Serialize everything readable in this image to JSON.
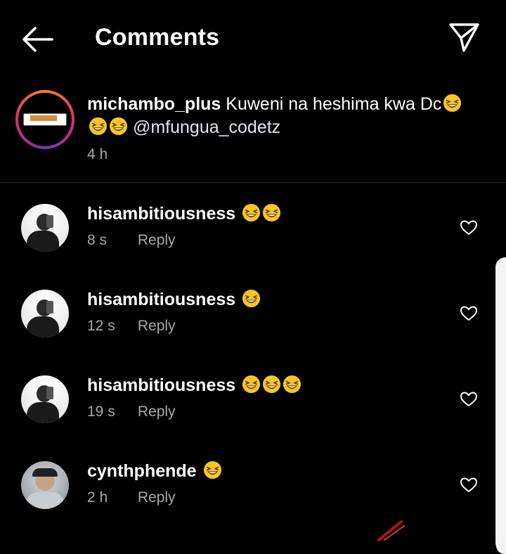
{
  "header": {
    "back_icon": "arrow-left-icon",
    "title": "Comments",
    "share_icon": "paper-plane-icon"
  },
  "caption": {
    "username": "michambo_plus",
    "text_before": "Kuweni na heshima kwa Dc",
    "mention": "@mfungua_codetz",
    "time": "4 h",
    "avatar_ring_colors": [
      "#f58529",
      "#dd2a7b",
      "#8134af"
    ]
  },
  "comments": [
    {
      "username": "hisambitiousness",
      "emoji_count": 2,
      "time": "8 s",
      "reply": "Reply"
    },
    {
      "username": "hisambitiousness",
      "emoji_count": 1,
      "time": "12 s",
      "reply": "Reply"
    },
    {
      "username": "hisambitiousness",
      "emoji_count": 3,
      "time": "19 s",
      "reply": "Reply"
    },
    {
      "username": "cynthphende",
      "emoji_count": 1,
      "time": "2 h",
      "reply": "Reply"
    }
  ],
  "icons": {
    "emoji": "grinning-squinting-face-icon",
    "like": "heart-outline-icon"
  },
  "colors": {
    "background": "#000000",
    "text": "#ffffff",
    "secondary_text": "#a8a8a8",
    "divider": "#262626"
  }
}
